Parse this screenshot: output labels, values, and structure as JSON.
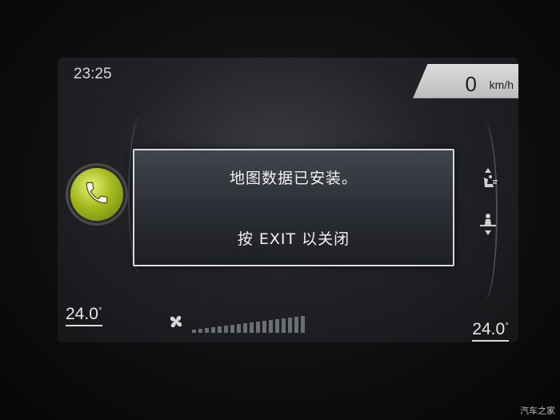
{
  "status_bar": {
    "time": "23:25",
    "speed_value": "0",
    "speed_unit": "km/h"
  },
  "dialog": {
    "line1": "地图数据已安装。",
    "line2": "按 EXIT 以关闭"
  },
  "climate": {
    "left_temp": "24.0",
    "right_temp": "24.0",
    "deg_symbol": "°",
    "fan_level_fraction": 0.0
  },
  "icons": {
    "phone": "phone-icon",
    "seat_recline": "seat-recline-icon",
    "seat_position": "seat-position-icon",
    "fan": "fan-icon"
  },
  "colors": {
    "phone_green": "#a3b91c",
    "dialog_border": "#d9d9d9"
  },
  "watermark": "汽车之家"
}
